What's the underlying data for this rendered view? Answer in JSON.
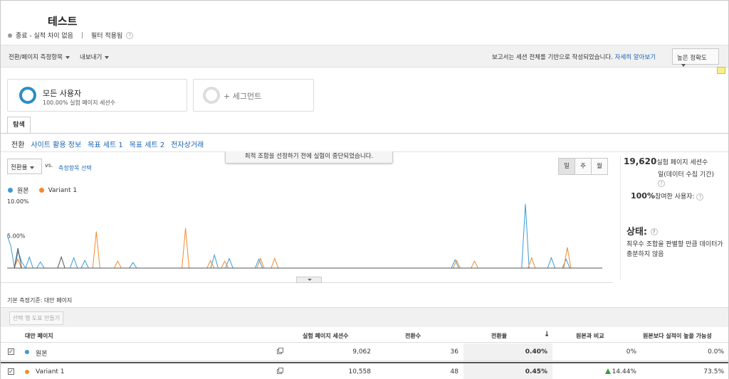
{
  "header": {
    "title": "테스트",
    "status": "종료 - 실적 차이 없음",
    "filter": "필터 적용됨"
  },
  "toolbar": {
    "conversion_menu": "전환/페이지 측정항목",
    "export_menu": "내보내기",
    "report_note": "보고서는 세션 전체를 기반으로 작성되었습니다.",
    "learn_more": "자세히 알아보기",
    "accuracy": "높은 정확도"
  },
  "segments": {
    "all_users_title": "모든 사용자",
    "all_users_sub": "100.00% 실험 페이지 세션수",
    "add_segment": "+ 세그먼트"
  },
  "tabs": {
    "explore": "탐색",
    "subtabs": [
      "전환",
      "사이트 활용 정보",
      "목표 세트 1",
      "목표 세트 2",
      "전자상거래"
    ]
  },
  "chart_controls": {
    "metric": "전환율",
    "vs": "vs.",
    "choose_metric": "측정항목 선택",
    "banner": "최적 조합을 선정하기 전에 실험이 중단되었습니다.",
    "period_buttons": [
      "일",
      "주",
      "월"
    ]
  },
  "colors": {
    "original": "#3a9bd5",
    "variant": "#f28a2e",
    "accent": "#2a8ec9"
  },
  "chart_data": {
    "type": "line",
    "y_ticks": [
      "10.00%",
      "5.00%"
    ],
    "ylim": [
      0,
      10
    ],
    "grid": false,
    "legend_position": "top-left",
    "series": [
      {
        "name": "원본",
        "values": [
          4.8,
          3.2,
          0,
          2.4,
          0.8,
          0,
          1.6,
          0,
          0,
          0.9,
          0,
          0,
          0,
          0,
          0,
          0,
          0,
          0,
          1.5,
          0,
          0,
          1.1,
          0,
          0,
          0,
          0,
          0,
          0,
          0,
          0,
          0,
          0,
          0,
          0,
          0.8,
          0,
          0,
          0,
          0,
          0,
          0,
          0,
          0,
          0,
          0,
          0,
          0,
          0,
          0,
          0,
          0,
          0,
          0,
          0,
          0,
          0,
          1.9,
          0,
          0,
          0,
          1.4,
          0,
          0,
          0,
          0,
          0,
          0,
          0,
          1.3,
          0,
          0,
          0,
          0,
          0,
          0,
          0,
          0,
          0,
          0,
          0,
          0,
          0,
          0,
          0,
          0,
          0,
          0,
          0,
          0,
          0,
          0,
          0,
          0,
          0,
          0,
          0,
          0,
          0,
          0,
          0,
          0,
          0,
          0,
          0,
          0,
          0,
          0,
          0,
          0,
          0,
          0,
          0,
          0,
          0,
          0,
          0,
          0,
          0,
          0,
          0,
          0,
          1.2,
          0,
          0,
          0,
          0,
          0,
          0,
          0,
          0,
          0,
          0,
          0,
          0,
          0,
          0,
          0,
          0,
          0,
          0,
          9.3,
          0,
          0,
          0,
          0,
          0,
          0,
          1.5,
          0,
          0,
          0,
          1.3,
          0,
          0,
          0,
          0,
          0,
          0,
          0,
          0,
          0
        ]
      },
      {
        "name": "Variant 1",
        "values": [
          0,
          0,
          0,
          1.3,
          0,
          0,
          0,
          0,
          0,
          0,
          0,
          0,
          0,
          0,
          0,
          0,
          0,
          0,
          0,
          0,
          0,
          0,
          0,
          0,
          0,
          5.3,
          0,
          0,
          0,
          0,
          0,
          1.0,
          0,
          0,
          0,
          0,
          0,
          0,
          0,
          0,
          0,
          0,
          0,
          0,
          0,
          0,
          0,
          0,
          0,
          0,
          5.8,
          0,
          0,
          0,
          0,
          0,
          0,
          1.1,
          0,
          0,
          0,
          1.0,
          0,
          0,
          0,
          0,
          0,
          0,
          0,
          0,
          0,
          1.4,
          0,
          0,
          0,
          1.4,
          0,
          0,
          0,
          0,
          0,
          0,
          0,
          0,
          0,
          0,
          0,
          0,
          0,
          0,
          0,
          0,
          0,
          0,
          0,
          0,
          0,
          0,
          0,
          0,
          0,
          0,
          0,
          0,
          0,
          0,
          0,
          0,
          0,
          0,
          0,
          0,
          0,
          0,
          0,
          0,
          0,
          0,
          0,
          0,
          0,
          0,
          0,
          0,
          0,
          0,
          1.1,
          0,
          0,
          0,
          0,
          1.0,
          0,
          0,
          0,
          0,
          0,
          0,
          0,
          0,
          0,
          0,
          0,
          0,
          0,
          0,
          0,
          1.5,
          0,
          0,
          0,
          0,
          0,
          0,
          0,
          0,
          0,
          3.0,
          0,
          0,
          0,
          0,
          0,
          0,
          0,
          0,
          0
        ]
      },
      {
        "name": "",
        "values": [
          0,
          0,
          0,
          2.9,
          0,
          0,
          0,
          0,
          0,
          0,
          0,
          0,
          0,
          0,
          0,
          1.6,
          0,
          0,
          0,
          0,
          0,
          0,
          0,
          0,
          0,
          0,
          0,
          0,
          0,
          0,
          0,
          0,
          0,
          0,
          0,
          0,
          0,
          0,
          0,
          0,
          0,
          0,
          0,
          0,
          0,
          0,
          0,
          0,
          0,
          0,
          0,
          0,
          0,
          0,
          0,
          0,
          0,
          0,
          0,
          0,
          0,
          0,
          0,
          0,
          0,
          0,
          0,
          0,
          0,
          0,
          0,
          0,
          0,
          0,
          0,
          0,
          0,
          0,
          0,
          0,
          0,
          0,
          0,
          0,
          0,
          0,
          0,
          0,
          0,
          0,
          0,
          0,
          0,
          0,
          0,
          0,
          0,
          0,
          0,
          0,
          0,
          0,
          0,
          0,
          0,
          0,
          0,
          0,
          0,
          0,
          0,
          0,
          0,
          0,
          0,
          0,
          0,
          0,
          0,
          0,
          0,
          0,
          0,
          0,
          0,
          0,
          0,
          0,
          0,
          0,
          0,
          0,
          0,
          0,
          0,
          0,
          0,
          0,
          0,
          0,
          0,
          0,
          0,
          0,
          0,
          0,
          0,
          0,
          0,
          0,
          0,
          0,
          0,
          0,
          0,
          0,
          0,
          0,
          0,
          0,
          0,
          0,
          0,
          0,
          0
        ]
      }
    ]
  },
  "right_panel": {
    "sessions_value": "19,620",
    "sessions_label": "실험 페이지 세션수",
    "sessions_sub": "일(데이터 수집 기간)",
    "engage_value": "100%",
    "engage_label": "참여한 사용자:",
    "status_title": "상태:",
    "status_text": "최우수 조합을 판별할 만큼 데이터가 충분하지 않음"
  },
  "table": {
    "base_metric": "기본 측정기준: 대안 페이지",
    "make_filter": "선택 행 도표 만들기",
    "columns": [
      "대안 페이지",
      "실험 페이지 세션수",
      "전환수",
      "전환율",
      "원본과 비교",
      "원본보다 실적이 높을 가능성"
    ],
    "rows": [
      {
        "name": "원본",
        "sessions": "9,062",
        "conversions": "36",
        "rate": "0.40%",
        "compare": "0%",
        "probability": "0.0%"
      },
      {
        "name": "Variant 1",
        "sessions": "10,558",
        "conversions": "48",
        "rate": "0.45%",
        "compare": "14.44%",
        "probability": "73.5%"
      }
    ]
  }
}
